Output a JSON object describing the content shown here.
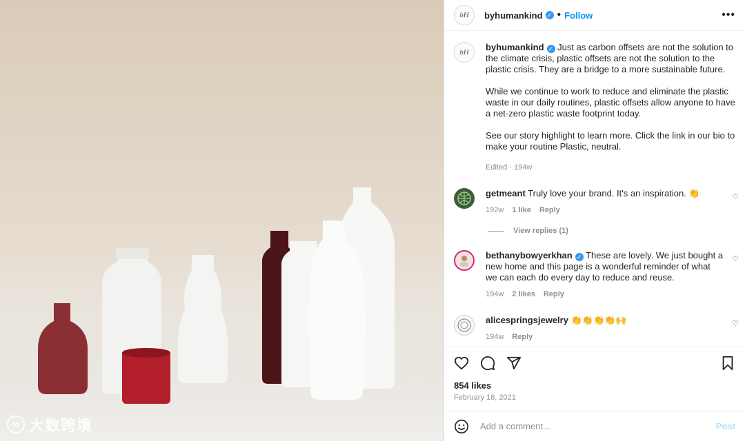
{
  "post": {
    "account": "byhumankind",
    "avatar_text": "bH",
    "follow_label": "Follow",
    "more_icon": "more-options-icon",
    "caption": {
      "paragraphs": [
        "Just as carbon offsets are not the solution to the climate crisis, plastic offsets are not the solution to the plastic crisis. They are a bridge to a more sustainable future.",
        "While we continue to work to reduce and eliminate the plastic waste in our daily routines, plastic offsets allow anyone to have a net-zero plastic waste footprint today.",
        "See our story highlight to learn more. Click the link in our bio to make your routine Plastic, neutral."
      ],
      "meta": "Edited · 194w"
    },
    "comments": [
      {
        "user": "getmeant",
        "text": "Truly love your brand. It's an inspiration. 👏",
        "age": "192w",
        "likes": "1 like",
        "reply": "Reply",
        "view_replies": "View replies (1)"
      },
      {
        "user": "bethanybowyerkhan",
        "text": "These are lovely. We just bought a new home and this page is a wonderful reminder of what we can each do every day to reduce and reuse.",
        "age": "194w",
        "likes": "2 likes",
        "reply": "Reply"
      },
      {
        "user": "alicespringsjewelry",
        "text": "👏👏👏👏🙌",
        "age": "194w",
        "reply": "Reply"
      }
    ],
    "likes": "854 likes",
    "date": "February 18, 2021",
    "composer": {
      "placeholder": "Add a comment...",
      "post_label": "Post"
    }
  },
  "watermark": "大数跨境",
  "colors": {
    "accent": "#0095f6",
    "verified": "#3897f0",
    "muted": "#8e8e8e",
    "post_disabled": "#b2dffc"
  }
}
